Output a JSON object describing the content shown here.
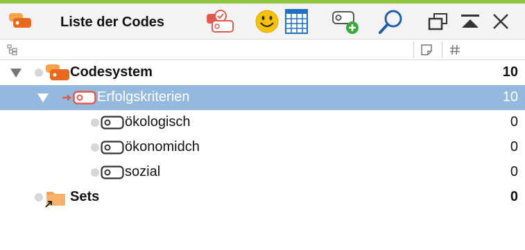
{
  "window": {
    "title": "Liste der Codes",
    "accent_color": "#8cc63f"
  },
  "toolbar": {
    "icons": [
      "code-system-icon",
      "activate-codes-icon",
      "emoticode-icon",
      "code-matrix-icon",
      "new-code-icon",
      "search-icon",
      "undock-icon",
      "maximize-icon",
      "close-icon"
    ]
  },
  "columns": {
    "memo_icon": "memo-column-icon",
    "count_icon": "hash-column-icon"
  },
  "tree": {
    "root": {
      "label": "Codesystem",
      "count": "10"
    },
    "category": {
      "label": "Erfolgskriterien",
      "count": "10",
      "color": "#e05a4f"
    },
    "children": [
      {
        "label": "ökologisch",
        "count": "0"
      },
      {
        "label": "ökonomidch",
        "count": "0"
      },
      {
        "label": "sozial",
        "count": "0"
      }
    ],
    "sets": {
      "label": "Sets",
      "count": "0"
    }
  },
  "colors": {
    "selection": "#93b9de",
    "code_orange": "#e8681f",
    "folder_orange": "#f6a24a"
  }
}
